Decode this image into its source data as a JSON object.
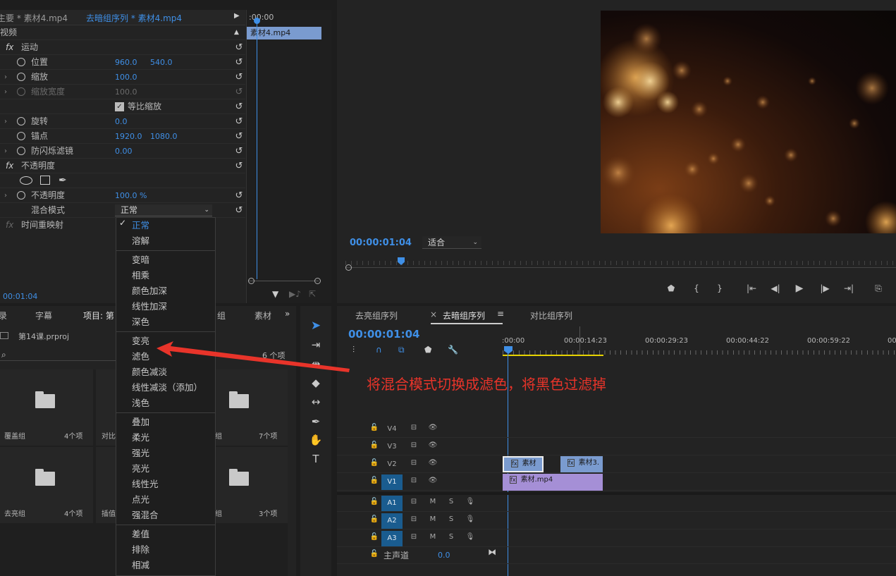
{
  "effect_controls": {
    "tab_main": "主要 * 素材4.mp4",
    "tab_seq": "去暗组序列 * 素材4.mp4",
    "section_video": "视频",
    "motion": {
      "name": "运动",
      "position": {
        "label": "位置",
        "x": "960.0",
        "y": "540.0"
      },
      "scale": {
        "label": "缩放",
        "value": "100.0"
      },
      "scale_width": {
        "label": "缩放宽度",
        "value": "100.0"
      },
      "uniform_scale": "等比缩放",
      "rotation": {
        "label": "旋转",
        "value": "0.0"
      },
      "anchor": {
        "label": "锚点",
        "x": "1920.0",
        "y": "1080.0"
      },
      "flicker": {
        "label": "防闪烁滤镜",
        "value": "0.00"
      }
    },
    "opacity": {
      "name": "不透明度",
      "label": "不透明度",
      "value": "100.0 %",
      "blend_label": "混合模式",
      "blend_value": "正常"
    },
    "time_remap": "时间重映射",
    "mini_clip": "素材4.mp4",
    "mini_time": ":00:00",
    "timecode": "00:01:04"
  },
  "blend_menu": {
    "groups": [
      [
        "正常",
        "溶解"
      ],
      [
        "变暗",
        "相乘",
        "颜色加深",
        "线性加深",
        "深色"
      ],
      [
        "变亮",
        "滤色",
        "颜色减淡",
        "线性减淡（添加）",
        "浅色"
      ],
      [
        "叠加",
        "柔光",
        "强光",
        "亮光",
        "线性光",
        "点光",
        "强混合"
      ],
      [
        "差值",
        "排除",
        "相减"
      ]
    ],
    "selected": "正常"
  },
  "program": {
    "timecode": "00:00:01:04",
    "fit": "适合"
  },
  "project_panel": {
    "tabs": [
      "录",
      "字幕",
      "项目: 第",
      "组",
      "素材"
    ],
    "file": "第14课.prproj",
    "count": "6 个项",
    "bins": [
      {
        "name": "覆盖组",
        "count": "4个项"
      },
      {
        "name": "对比",
        "count": ""
      },
      {
        "name": "组",
        "count": "7个项"
      },
      {
        "name": "去亮组",
        "count": "4个项"
      },
      {
        "name": "插值",
        "count": ""
      },
      {
        "name": "组",
        "count": "3个项"
      }
    ]
  },
  "timeline": {
    "tabs": [
      "去亮组序列",
      "去暗组序列",
      "对比组序列"
    ],
    "active_tab": "去暗组序列",
    "timecode": "00:00:01:04",
    "ruler": [
      ":00:00",
      "00:00:14:23",
      "00:00:29:23",
      "00:00:44:22",
      "00:00:59:22",
      "00"
    ],
    "video_tracks": [
      "V4",
      "V3",
      "V2",
      "V1"
    ],
    "audio_tracks": [
      "A1",
      "A2",
      "A3"
    ],
    "master": {
      "label": "主声道",
      "value": "0.0"
    },
    "mute": "M",
    "solo": "S",
    "clips": {
      "v2a": "素材",
      "v2b": "素材3.",
      "v1": "素材.mp4"
    }
  },
  "annotation": "将混合模式切换成滤色，将黑色过滤掉",
  "colors": {
    "accent": "#3f8fe6",
    "annotation": "#e8342a",
    "clip_blue": "#7a9bcf",
    "clip_purple": "#a58fd6"
  }
}
